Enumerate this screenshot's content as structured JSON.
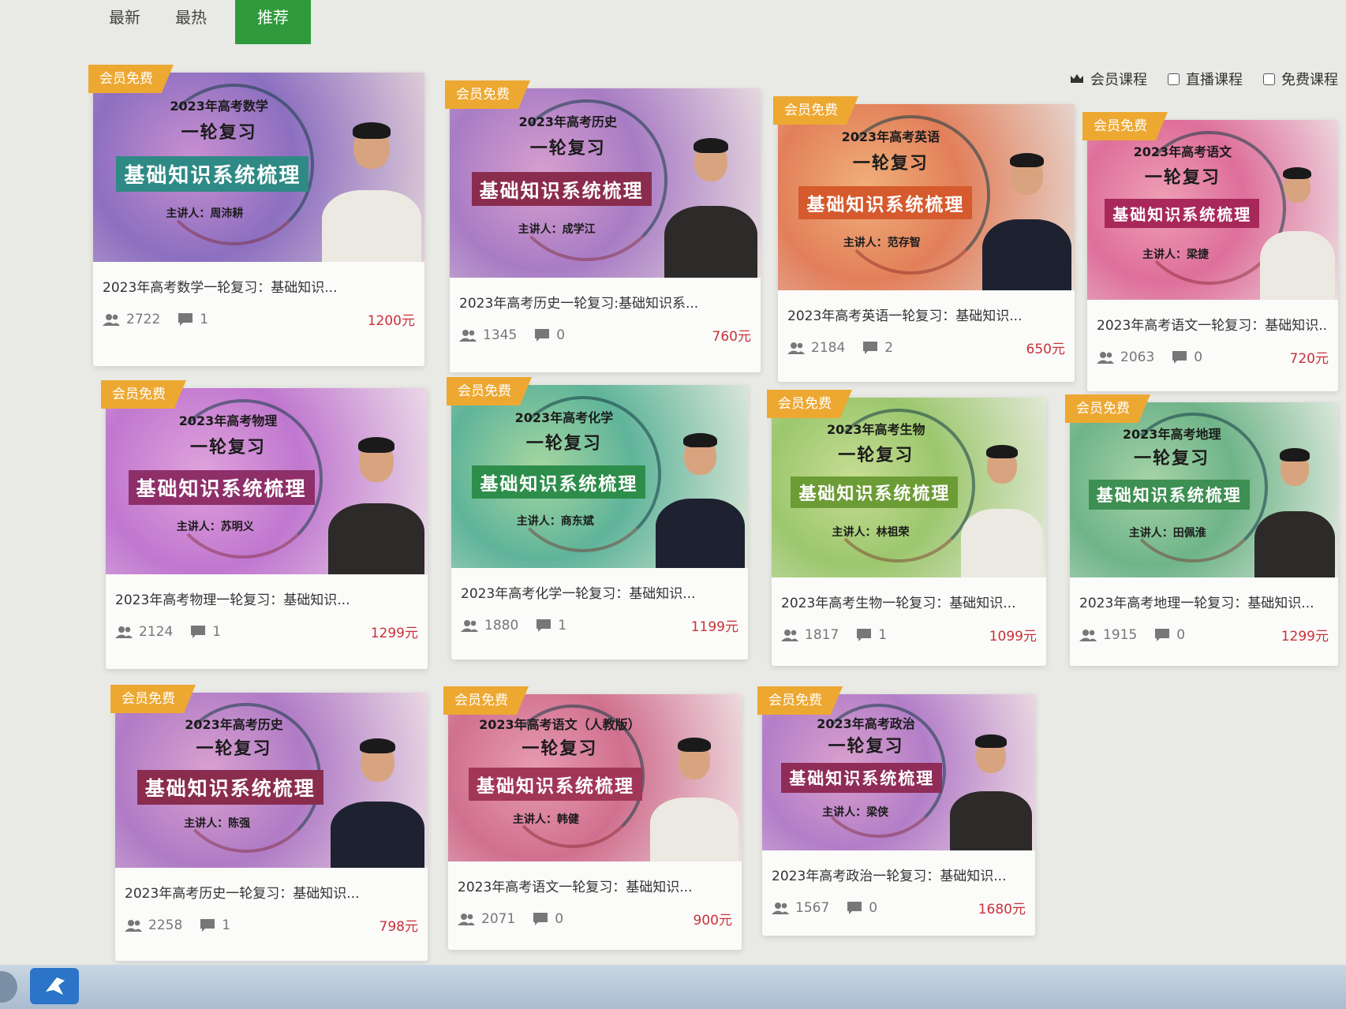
{
  "tabs": [
    "最新",
    "最热",
    "推荐"
  ],
  "active_tab": "推荐",
  "filters": [
    {
      "label": "会员课程",
      "icon": "crown-icon"
    },
    {
      "label": "直播课程",
      "icon": "checkbox-icon"
    },
    {
      "label": "免费课程",
      "icon": "checkbox-icon"
    }
  ],
  "badge_text": "会员免费",
  "headline_line2": "一轮复习",
  "banner_text": "基础知识系统梳理",
  "courses": [
    {
      "thumb_title": "2023年高考数学",
      "lecturer": "主讲人：周沛耕",
      "title": "2023年高考数学一轮复习：基础知识...",
      "students": "2722",
      "comments": "1",
      "price": "1200元",
      "bg": [
        "#8c6fc0",
        "#c98fd0",
        "#e2d0d8"
      ],
      "banner_color": "#2f8a86"
    },
    {
      "thumb_title": "2023年高考历史",
      "lecturer": "主讲人：成学江",
      "title": "2023年高考历史一轮复习:基础知识系...",
      "students": "1345",
      "comments": "0",
      "price": "760元",
      "bg": [
        "#a87cc4",
        "#d89fcf",
        "#e9dde0"
      ],
      "banner_color": "#8a2c4e"
    },
    {
      "thumb_title": "2023年高考英语",
      "lecturer": "主讲人：范存智",
      "title": "2023年高考英语一轮复习：基础知识...",
      "students": "2184",
      "comments": "2",
      "price": "650元",
      "bg": [
        "#e27f5a",
        "#f0b07a",
        "#e6d8d2"
      ],
      "banner_color": "#d55a2e"
    },
    {
      "thumb_title": "2023年高考语文",
      "lecturer": "主讲人：梁捷",
      "title": "2023年高考语文一轮复习：基础知识...",
      "students": "2063",
      "comments": "0",
      "price": "720元",
      "bg": [
        "#de6f9a",
        "#ef9fb6",
        "#eedde2"
      ],
      "banner_color": "#a8285a"
    },
    {
      "thumb_title": "2023年高考物理",
      "lecturer": "主讲人：苏明义",
      "title": "2023年高考物理一轮复习：基础知识...",
      "students": "2124",
      "comments": "1",
      "price": "1299元",
      "bg": [
        "#c077cf",
        "#e0a2db",
        "#ecdee8"
      ],
      "banner_color": "#8e2f6a"
    },
    {
      "thumb_title": "2023年高考化学",
      "lecturer": "主讲人：商东斌",
      "title": "2023年高考化学一轮复习：基础知识...",
      "students": "1880",
      "comments": "1",
      "price": "1199元",
      "bg": [
        "#5fb49a",
        "#a5d6a0",
        "#e1e9dc"
      ],
      "banner_color": "#2d8d4a"
    },
    {
      "thumb_title": "2023年高考生物",
      "lecturer": "主讲人：林祖荣",
      "title": "2023年高考生物一轮复习：基础知识...",
      "students": "1817",
      "comments": "1",
      "price": "1099元",
      "bg": [
        "#9cc76e",
        "#c7dd93",
        "#e6eadb"
      ],
      "banner_color": "#6c9c35"
    },
    {
      "thumb_title": "2023年高考地理",
      "lecturer": "主讲人：田佩淮",
      "title": "2023年高考地理一轮复习：基础知识...",
      "students": "1915",
      "comments": "0",
      "price": "1299元",
      "bg": [
        "#6fb489",
        "#a6d3a7",
        "#e3ebe1"
      ],
      "banner_color": "#3d8f52"
    },
    {
      "thumb_title": "2023年高考历史",
      "lecturer": "主讲人：陈强",
      "title": "2023年高考历史一轮复习：基础知识...",
      "students": "2258",
      "comments": "1",
      "price": "798元",
      "bg": [
        "#b07bc6",
        "#d9a1cf",
        "#ecdde4"
      ],
      "banner_color": "#8a2c4e"
    },
    {
      "thumb_title": "2023年高考语文（人教版）",
      "lecturer": "主讲人：韩健",
      "title": "2023年高考语文一轮复习：基础知识...",
      "students": "2071",
      "comments": "0",
      "price": "900元",
      "bg": [
        "#d0708f",
        "#e79bb2",
        "#efdfe3"
      ],
      "banner_color": "#a23658"
    },
    {
      "thumb_title": "2023年高考政治",
      "lecturer": "主讲人：梁侠",
      "title": "2023年高考政治一轮复习：基础知识...",
      "students": "1567",
      "comments": "0",
      "price": "1680元",
      "bg": [
        "#b37ec8",
        "#d9a0cd",
        "#eddce3"
      ],
      "banner_color": "#8f2c57"
    }
  ],
  "taskbar_app_icon": "app-icon"
}
